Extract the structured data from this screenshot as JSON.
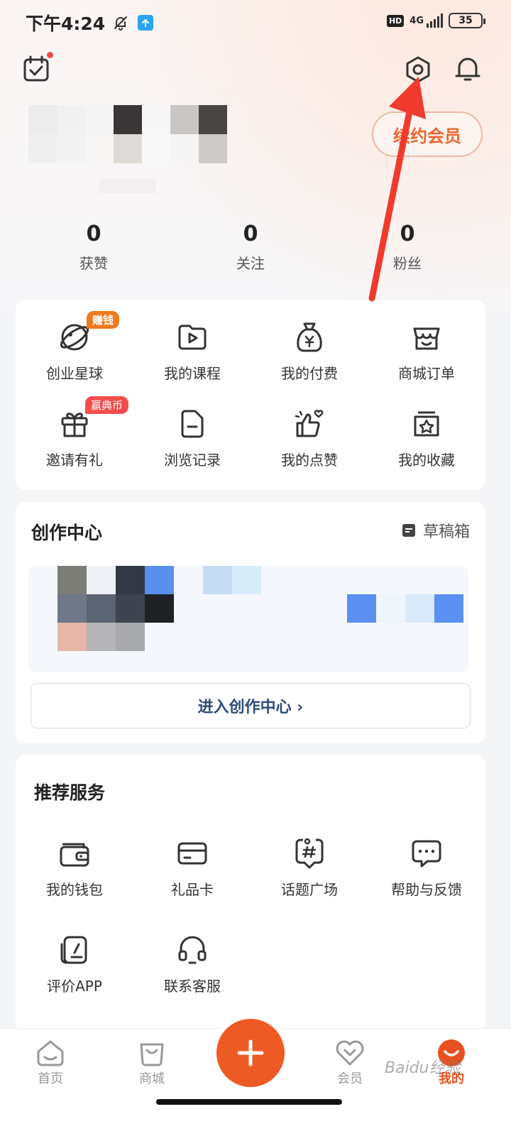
{
  "status_bar": {
    "time": "下午4:24",
    "network": "4G",
    "battery": "35"
  },
  "header": {
    "vip_button": "续约会员"
  },
  "stats": [
    {
      "value": "0",
      "label": "获赞"
    },
    {
      "value": "0",
      "label": "关注"
    },
    {
      "value": "0",
      "label": "粉丝"
    }
  ],
  "quick_menu": {
    "items": [
      {
        "label": "创业星球",
        "icon": "planet-icon",
        "tag": "赚钱"
      },
      {
        "label": "我的课程",
        "icon": "course-play-icon"
      },
      {
        "label": "我的付费",
        "icon": "money-bag-icon"
      },
      {
        "label": "商城订单",
        "icon": "shop-icon"
      },
      {
        "label": "邀请有礼",
        "icon": "gift-icon",
        "tag": "赢典币"
      },
      {
        "label": "浏览记录",
        "icon": "history-doc-icon"
      },
      {
        "label": "我的点赞",
        "icon": "thumbs-up-icon"
      },
      {
        "label": "我的收藏",
        "icon": "star-box-icon"
      }
    ]
  },
  "creation_center": {
    "title": "创作中心",
    "drafts_label": "草稿箱",
    "enter_button": "进入创作中心 ›"
  },
  "services": {
    "title": "推荐服务",
    "items": [
      {
        "label": "我的钱包",
        "icon": "wallet-icon"
      },
      {
        "label": "礼品卡",
        "icon": "gift-card-icon"
      },
      {
        "label": "话题广场",
        "icon": "topic-hash-icon"
      },
      {
        "label": "帮助与反馈",
        "icon": "chat-bubble-icon"
      },
      {
        "label": "评价APP",
        "icon": "rate-app-icon"
      },
      {
        "label": "联系客服",
        "icon": "headset-icon"
      }
    ]
  },
  "bottom_nav": {
    "items": [
      {
        "label": "首页",
        "icon": "home-icon"
      },
      {
        "label": "商城",
        "icon": "shop-bag-icon"
      },
      {
        "label": "会员",
        "icon": "vip-heart-icon"
      },
      {
        "label": "我的",
        "icon": "me-smile-icon",
        "active": true
      }
    ]
  },
  "watermark": "Baidu经验",
  "colors": {
    "accent": "#ee5a24",
    "vip_text": "#e8672c",
    "link_blue": "#2e4b7a",
    "arrow_red": "#f03a2e"
  }
}
